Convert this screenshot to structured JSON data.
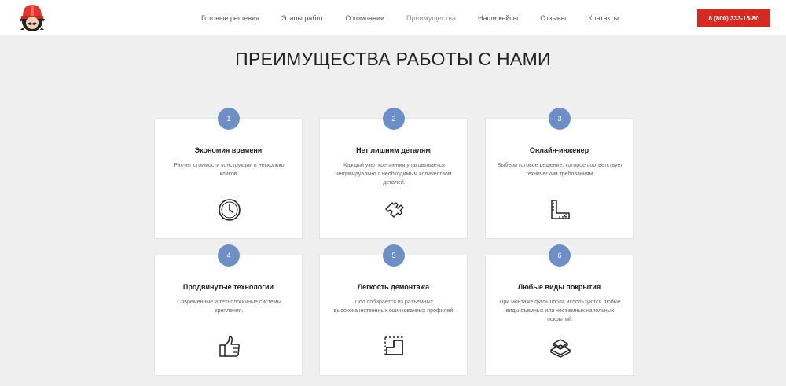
{
  "header": {
    "nav": [
      "Готовые решения",
      "Этапы работ",
      "О компании",
      "Преимущества",
      "Наши кейсы",
      "Отзывы",
      "Контакты"
    ],
    "phone": "8 (800) 333-15-80"
  },
  "section": {
    "title": "ПРЕИМУЩЕСТВА РАБОТЫ С НАМИ",
    "cards": [
      {
        "num": "1",
        "title": "Экономия времени",
        "text": "Расчет стоимости конструкции в несколько кликов.",
        "icon": "clock-icon"
      },
      {
        "num": "2",
        "title": "Нет лишним деталям",
        "text": "Каждый узел крепления упаковывается индивидуально с необходимым количеством деталей.",
        "icon": "puzzle-icon"
      },
      {
        "num": "3",
        "title": "Онлайн-инженер",
        "text": "Выбери готовое решение, которое соответствует техническим требованиям.",
        "icon": "ruler-icon"
      },
      {
        "num": "4",
        "title": "Продвинутые технологии",
        "text": "Современные и технологичные системы крепления.",
        "icon": "thumbs-up-icon"
      },
      {
        "num": "5",
        "title": "Легкость демонтажа",
        "text": "Пол собирается из разъемных высококачественных оцинкованных профилей.",
        "icon": "frame-icon"
      },
      {
        "num": "6",
        "title": "Любые виды покрытия",
        "text": "При монтаже фальшпола используются любые виды съемных или несъемных напольных покрытий.",
        "icon": "layers-icon"
      }
    ]
  }
}
